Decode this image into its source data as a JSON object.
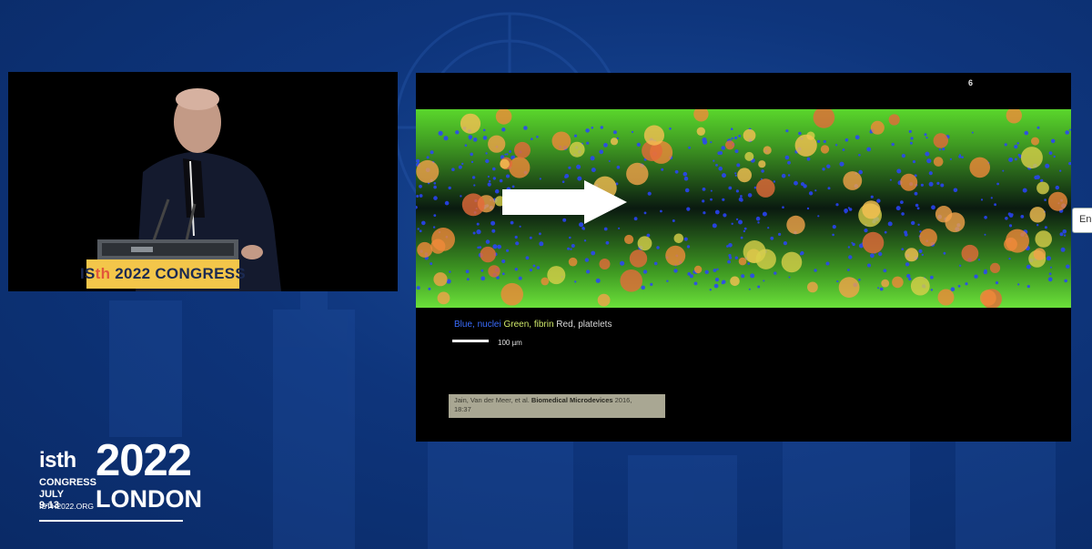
{
  "speaker_feed": {
    "podium_prefix": "IS",
    "podium_th": "th",
    "podium_rest": " 2022 CONGRESS"
  },
  "slide": {
    "number": "6",
    "legend": {
      "blue": "Blue, nuclei",
      "green": "Green, fibrin",
      "red": "Red, platelets"
    },
    "scale_label": "100 µm",
    "citation": {
      "prefix": "Jain, Van der Meer, et al.",
      "journal": "Biomedical Microdevices",
      "suffix": "2016,",
      "line2": "18:37"
    }
  },
  "side_tab": {
    "label": "En"
  },
  "branding": {
    "isth": "isth",
    "year": "2022",
    "congress": "CONGRESS",
    "dates": "JULY 9-13",
    "city": "LONDON",
    "url": "ISTH2022.ORG"
  },
  "colors": {
    "background": "#0e357c",
    "podium": "#f3c64a",
    "fibrin": "#4fd12a",
    "platelet": "#e8863a",
    "nuclei": "#1f3cff"
  }
}
